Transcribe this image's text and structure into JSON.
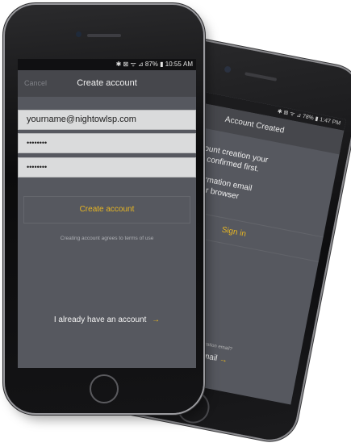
{
  "back_phone": {
    "status": "✱ ⊠ ᯤ ⊿ 78% ▮ 1:47 PM",
    "title": "Account Created",
    "line1": "ete your account creation your",
    "line2": "ress must be confirmed first.",
    "line3": "nk in the confirmation email",
    "line4": "e URL into your browser",
    "sign_in": "Sign in",
    "resend_prompt": "t verification email?",
    "resend_link": "d email",
    "resend_arrow": "→",
    "accent_color": "#e7b623"
  },
  "front_phone": {
    "status": "✱ ⊠ ᯤ ⊿ 87% ▮ 10:55 AM",
    "cancel": "Cancel",
    "title": "Create account",
    "email_value": "yourname@nightowlsp.com",
    "password_value": "••••••••",
    "confirm_password_value": "••••••••",
    "create_button": "Create account",
    "terms": "Creating account agrees to  terms of use",
    "have_account": "I already have an account",
    "have_account_arrow": "→",
    "accent_color": "#e7b623"
  }
}
